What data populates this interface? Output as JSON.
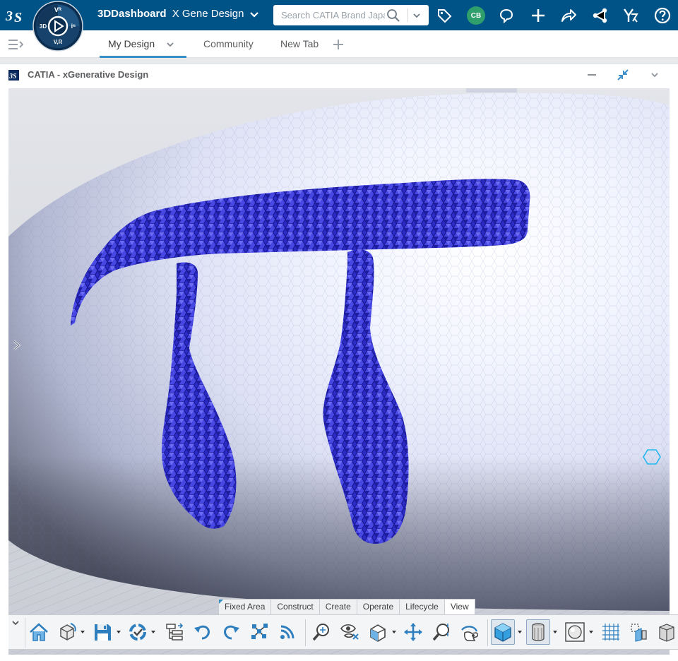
{
  "colors": {
    "topbar": "#005386",
    "accent": "#368ec4",
    "avatar": "#2f9f6b",
    "model_blue": "#2f2fc8",
    "surface": "#e9ecf8"
  },
  "header": {
    "brand_bold": "3DDashboard",
    "brand_title": "X Gene Design",
    "search_placeholder": "Search CATIA Brand Japan",
    "avatar_initials": "CB",
    "compass": {
      "left": "3D",
      "top": "Vᴿ",
      "right": "i⁶",
      "bottom": "V,R"
    },
    "icons": [
      "tag-icon",
      "chat-icon",
      "add-icon",
      "share-icon",
      "network-icon",
      "apps-icon",
      "help-icon"
    ]
  },
  "tabs": [
    {
      "label": "My Design",
      "active": true
    },
    {
      "label": "Community",
      "active": false
    },
    {
      "label": "New Tab",
      "active": false
    }
  ],
  "widget": {
    "title": "CATIA - xGenerative Design"
  },
  "action_bar": {
    "tabs": [
      {
        "label": "Fixed Area",
        "active": false
      },
      {
        "label": "Construct",
        "active": false
      },
      {
        "label": "Create",
        "active": false
      },
      {
        "label": "Operate",
        "active": false
      },
      {
        "label": "Lifecycle",
        "active": false
      },
      {
        "label": "View",
        "active": true
      }
    ],
    "tools": [
      "home-icon",
      "rotate-view-icon",
      "save-icon",
      "refresh-icon",
      "tree-icon",
      "undo-icon",
      "redo-icon",
      "graph-icon",
      "broadcast-icon",
      "zoom-fit-icon",
      "view-eye-icon",
      "view-cube-icon",
      "pan-icon",
      "zoom-icon",
      "rotate-hand-icon",
      "shaded-cube-icon",
      "cylinder-icon",
      "sphere-icon",
      "grid-icon",
      "section-icon",
      "more-icon"
    ]
  }
}
